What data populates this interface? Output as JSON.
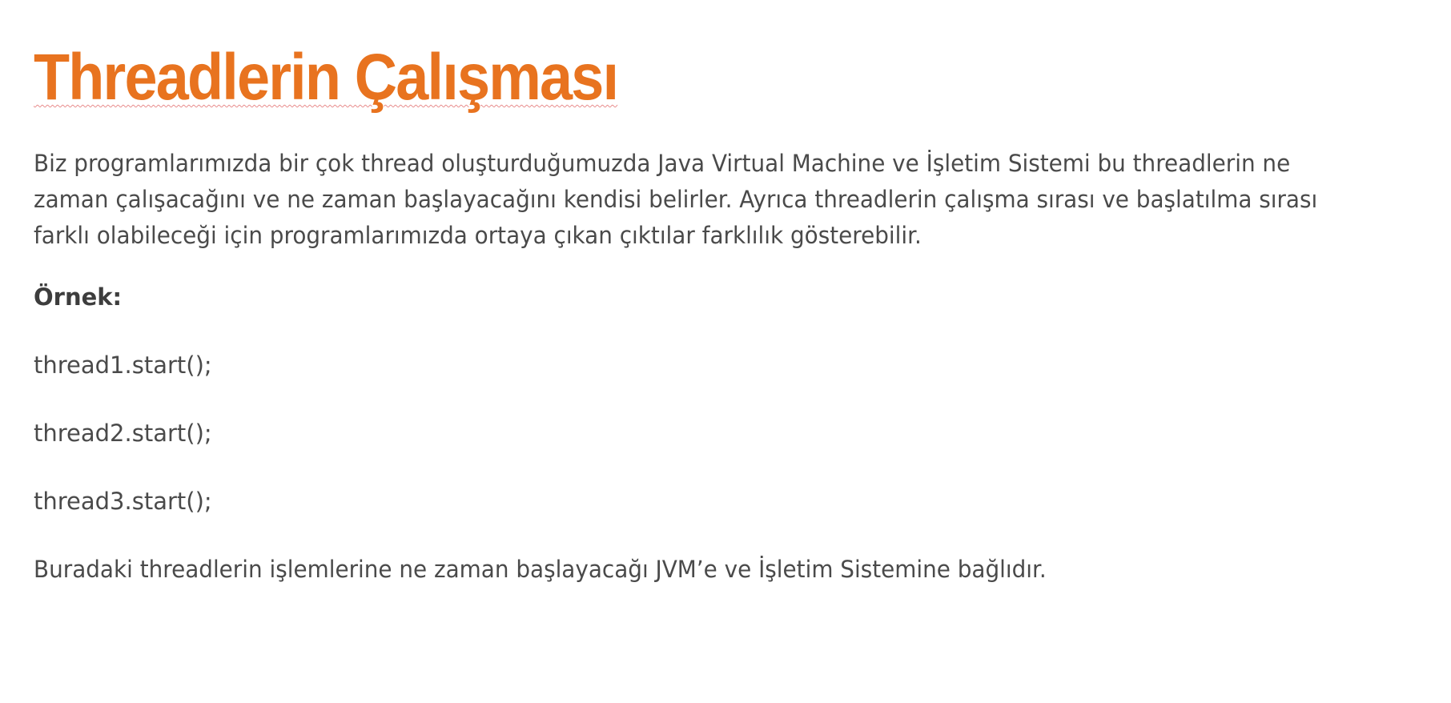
{
  "title": "Threadlerin Çalışması",
  "intro_paragraph": "Biz programlarımızda bir çok thread oluşturduğumuzda Java Virtual Machine ve İşletim Sistemi bu threadlerin ne zaman çalışacağını ve ne zaman başlayacağını kendisi belirler. Ayrıca threadlerin çalışma sırası ve başlatılma sırası farklı olabileceği için programlarımızda ortaya çıkan çıktılar farklılık gösterebilir.",
  "example_label": "Örnek:",
  "code_lines": [
    "thread1.start();",
    "thread2.start();",
    "thread3.start();"
  ],
  "closing_paragraph": "Buradaki threadlerin işlemlerine ne zaman başlayacağı JVM’e ve İşletim Sistemine bağlıdır.",
  "colors": {
    "title": "#e8731f",
    "body_text": "#4a4a4a",
    "spellcheck_underline": "#e88a8a"
  }
}
